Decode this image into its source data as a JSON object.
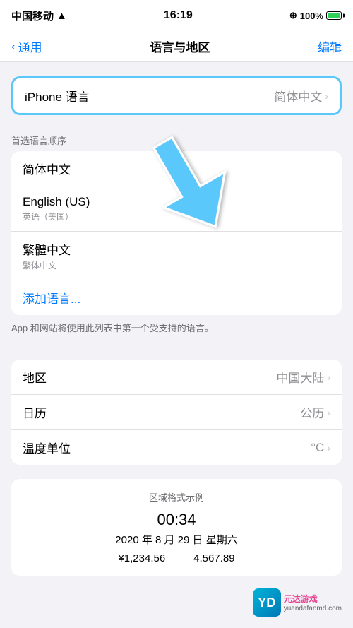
{
  "statusBar": {
    "carrier": "中国移动",
    "time": "16:19",
    "battery": "100%"
  },
  "navBar": {
    "backLabel": "通用",
    "title": "语言与地区",
    "actionLabel": "编辑"
  },
  "iphoneLanguage": {
    "label": "iPhone 语言",
    "value": "简体中文"
  },
  "preferredLanguages": {
    "sectionLabel": "首选语言顺序",
    "items": [
      {
        "main": "简体中文",
        "sub": ""
      },
      {
        "main": "English (US)",
        "sub": "英语（美国）"
      },
      {
        "main": "繁體中文",
        "sub": "繁体中文"
      }
    ],
    "addLabel": "添加语言...",
    "footerText": "App 和网站将使用此列表中第一个受支持的语言。"
  },
  "region": {
    "label": "地区",
    "value": "中国大陆"
  },
  "calendar": {
    "label": "日历",
    "value": "公历"
  },
  "temperature": {
    "label": "温度单位",
    "value": "°C"
  },
  "formatExample": {
    "title": "区域格式示例",
    "time": "00:34",
    "date": "2020 年 8 月 29 日 星期六",
    "number1": "¥1,234.56",
    "number2": "4,567.89"
  },
  "watermark": {
    "text1": "元达游戏",
    "text2": "yuandafanmd.com"
  }
}
